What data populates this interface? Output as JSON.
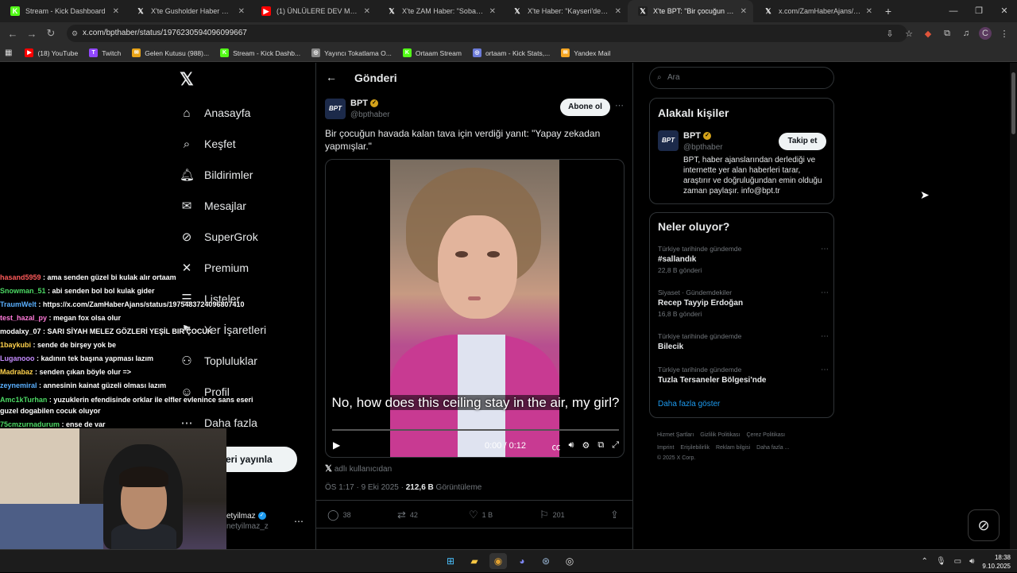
{
  "browser": {
    "tabs": [
      {
        "title": "Stream - Kick Dashboard",
        "icon": "kick-icon",
        "color": "#53fc18",
        "glyph": "K",
        "active": false
      },
      {
        "title": "X'te Gusholder Haber Bülteni: \"",
        "icon": "x-icon",
        "color": "#1f1f1f",
        "glyph": "𝕏",
        "active": false
      },
      {
        "title": "(1) ÜNLÜLERE DEV MADDE BA",
        "icon": "youtube-icon",
        "color": "#ff0000",
        "glyph": "▶",
        "active": false
      },
      {
        "title": "X'te ZAM Haber: \"Soba güzelli",
        "icon": "x-icon",
        "color": "#1f1f1f",
        "glyph": "𝕏",
        "active": false
      },
      {
        "title": "X'te Haber: \"Kayseri'de bir sürü",
        "icon": "x-icon",
        "color": "#1f1f1f",
        "glyph": "𝕏",
        "active": false
      },
      {
        "title": "X'te BPT: \"Bir çocuğun havada",
        "icon": "x-icon",
        "color": "#1f1f1f",
        "glyph": "𝕏",
        "active": true
      },
      {
        "title": "x.com/ZamHaberAjans/status/1",
        "icon": "x-icon",
        "color": "#1f1f1f",
        "glyph": "𝕏",
        "active": false
      }
    ],
    "url": "x.com/bpthaber/status/1976230594096099667",
    "bookmarks": [
      {
        "label": "(18) YouTube",
        "color": "#ff0000",
        "glyph": "▶"
      },
      {
        "label": "Twitch",
        "color": "#9146ff",
        "glyph": "T"
      },
      {
        "label": "Gelen Kutusu (988)...",
        "color": "#e8a317",
        "glyph": "✉"
      },
      {
        "label": "Stream - Kick Dashb...",
        "color": "#53fc18",
        "glyph": "K"
      },
      {
        "label": "Yayıncı Tokatlama O...",
        "color": "#888888",
        "glyph": "◎"
      },
      {
        "label": "Ortaam Stream",
        "color": "#53fc18",
        "glyph": "K"
      },
      {
        "label": "ortaam - Kick Stats,...",
        "color": "#6c7bd9",
        "glyph": "◎"
      },
      {
        "label": "Yandex Mail",
        "color": "#f5a623",
        "glyph": "✉"
      }
    ],
    "profile_initial": "C"
  },
  "sidebar": {
    "items": [
      {
        "label": "Anasayfa",
        "icon": "home-icon",
        "glyph": "⌂"
      },
      {
        "label": "Keşfet",
        "icon": "search-icon",
        "glyph": "⌕"
      },
      {
        "label": "Bildirimler",
        "icon": "bell-icon",
        "glyph": "🔔︎"
      },
      {
        "label": "Mesajlar",
        "icon": "mail-icon",
        "glyph": "✉"
      },
      {
        "label": "SuperGrok",
        "icon": "grok-icon",
        "glyph": "⊘"
      },
      {
        "label": "Premium",
        "icon": "x-premium-icon",
        "glyph": "✕"
      },
      {
        "label": "Listeler",
        "icon": "list-icon",
        "glyph": "☰"
      },
      {
        "label": "Yer İşaretleri",
        "icon": "bookmark-icon",
        "glyph": "⚑"
      },
      {
        "label": "Topluluklar",
        "icon": "communities-icon",
        "glyph": "⚇"
      },
      {
        "label": "Profil",
        "icon": "profile-icon",
        "glyph": "☺"
      },
      {
        "label": "Daha fazla",
        "icon": "more-circle-icon",
        "glyph": "⋯"
      }
    ],
    "post_button": "eri yayınla",
    "account_name": "etyilmaz",
    "account_handle": "netyilmaz_z"
  },
  "post": {
    "header_title": "Gönderi",
    "author_name": "BPT",
    "author_handle": "@bpthaber",
    "avatar_text": "BPT",
    "follow_label": "Abone ol",
    "text": "Bir çocuğun havada kalan tava için verdiği yanıt: \"Yapay zekadan yapmışlar.\"",
    "video": {
      "caption": "No, how does this ceiling stay in the air, my girl?",
      "time": "0:00 / 0:12",
      "progress": 0
    },
    "source_label": "adlı kullanıcıdan",
    "timestamp": "ÖS 1:17 · 9 Eki 2025 ·",
    "views_value": "212,6 B",
    "views_label": "Görüntüleme",
    "replies": "38",
    "reposts": "42",
    "likes": "1 B",
    "bookmarks": "201"
  },
  "right": {
    "search_placeholder": "Ara",
    "related_title": "Alakalı kişiler",
    "related_name": "BPT",
    "related_handle": "@bpthaber",
    "related_follow": "Takip et",
    "related_bio": "BPT, haber ajanslarından derlediği ve internette yer alan haberleri tarar, araştırır ve doğruluğundan emin olduğu zaman paylaşır. info@bpt.tr",
    "trends_title": "Neler oluyor?",
    "trends": [
      {
        "category": "Türkiye tarihinde gündemde",
        "name": "#sallandık",
        "count": "22,8 B gönderi"
      },
      {
        "category": "Siyaset · Gündemdekiler",
        "name": "Recep Tayyip Erdoğan",
        "count": "16,8 B gönderi"
      },
      {
        "category": "Türkiye tarihinde gündemde",
        "name": "Bilecik",
        "count": ""
      },
      {
        "category": "Türkiye tarihinde gündemde",
        "name": "Tuzla Tersaneler Bölgesi'nde",
        "count": ""
      }
    ],
    "show_more": "Daha fazla göster",
    "footer_links": [
      "Hizmet Şartları",
      "Gizlilik Politikası",
      "Çerez Politikası",
      "Imprint",
      "Erişilebilirlik",
      "Reklam bilgisi",
      "Daha fazla ..."
    ],
    "copyright": "© 2025 X Corp."
  },
  "chat": [
    {
      "user": "hasand5959",
      "color": "#ff5a5a",
      "msg": "ama senden güzel bi kulak alır ortaam"
    },
    {
      "user": "Snowman_51",
      "color": "#4cd964",
      "msg": "abi senden bol bol kulak gider"
    },
    {
      "user": "TraumWelt",
      "color": "#5ab0ff",
      "msg": "https://x.com/ZamHaberAjans/status/1975483724096807410"
    },
    {
      "user": "test_hazal_py",
      "color": "#ff7ad9",
      "msg": "megan fox olsa olur"
    },
    {
      "user": "modalxy_07",
      "color": "#ffffff",
      "msg": "SARI SİYAH MELEZ GÖZLERİ YEŞİL BIR ÇOCUK"
    },
    {
      "user": "1baykubi",
      "color": "#ffd24c",
      "msg": "sende de birşey yok be"
    },
    {
      "user": "Luganooo",
      "color": "#c58cff",
      "msg": "kadının tek başına yapması lazım"
    },
    {
      "user": "Madrabaz",
      "color": "#ffd24c",
      "msg": "senden çıkan böyle olur =>"
    },
    {
      "user": "zeynemiral",
      "color": "#5ab0ff",
      "msg": "annesinin kainat güzeli olması lazım"
    },
    {
      "user": "Amc1kTurhan",
      "color": "#4cd964",
      "msg": "yuzuklerin efendisinde orklar ile elfler evlenince sans eseri guzel dogabilen cocuk oluyor"
    },
    {
      "user": "75cmzurnadurum",
      "color": "#4cd964",
      "msg": "ense de var"
    }
  ],
  "taskbar": {
    "time": "18:38",
    "date": "9.10.2025"
  }
}
